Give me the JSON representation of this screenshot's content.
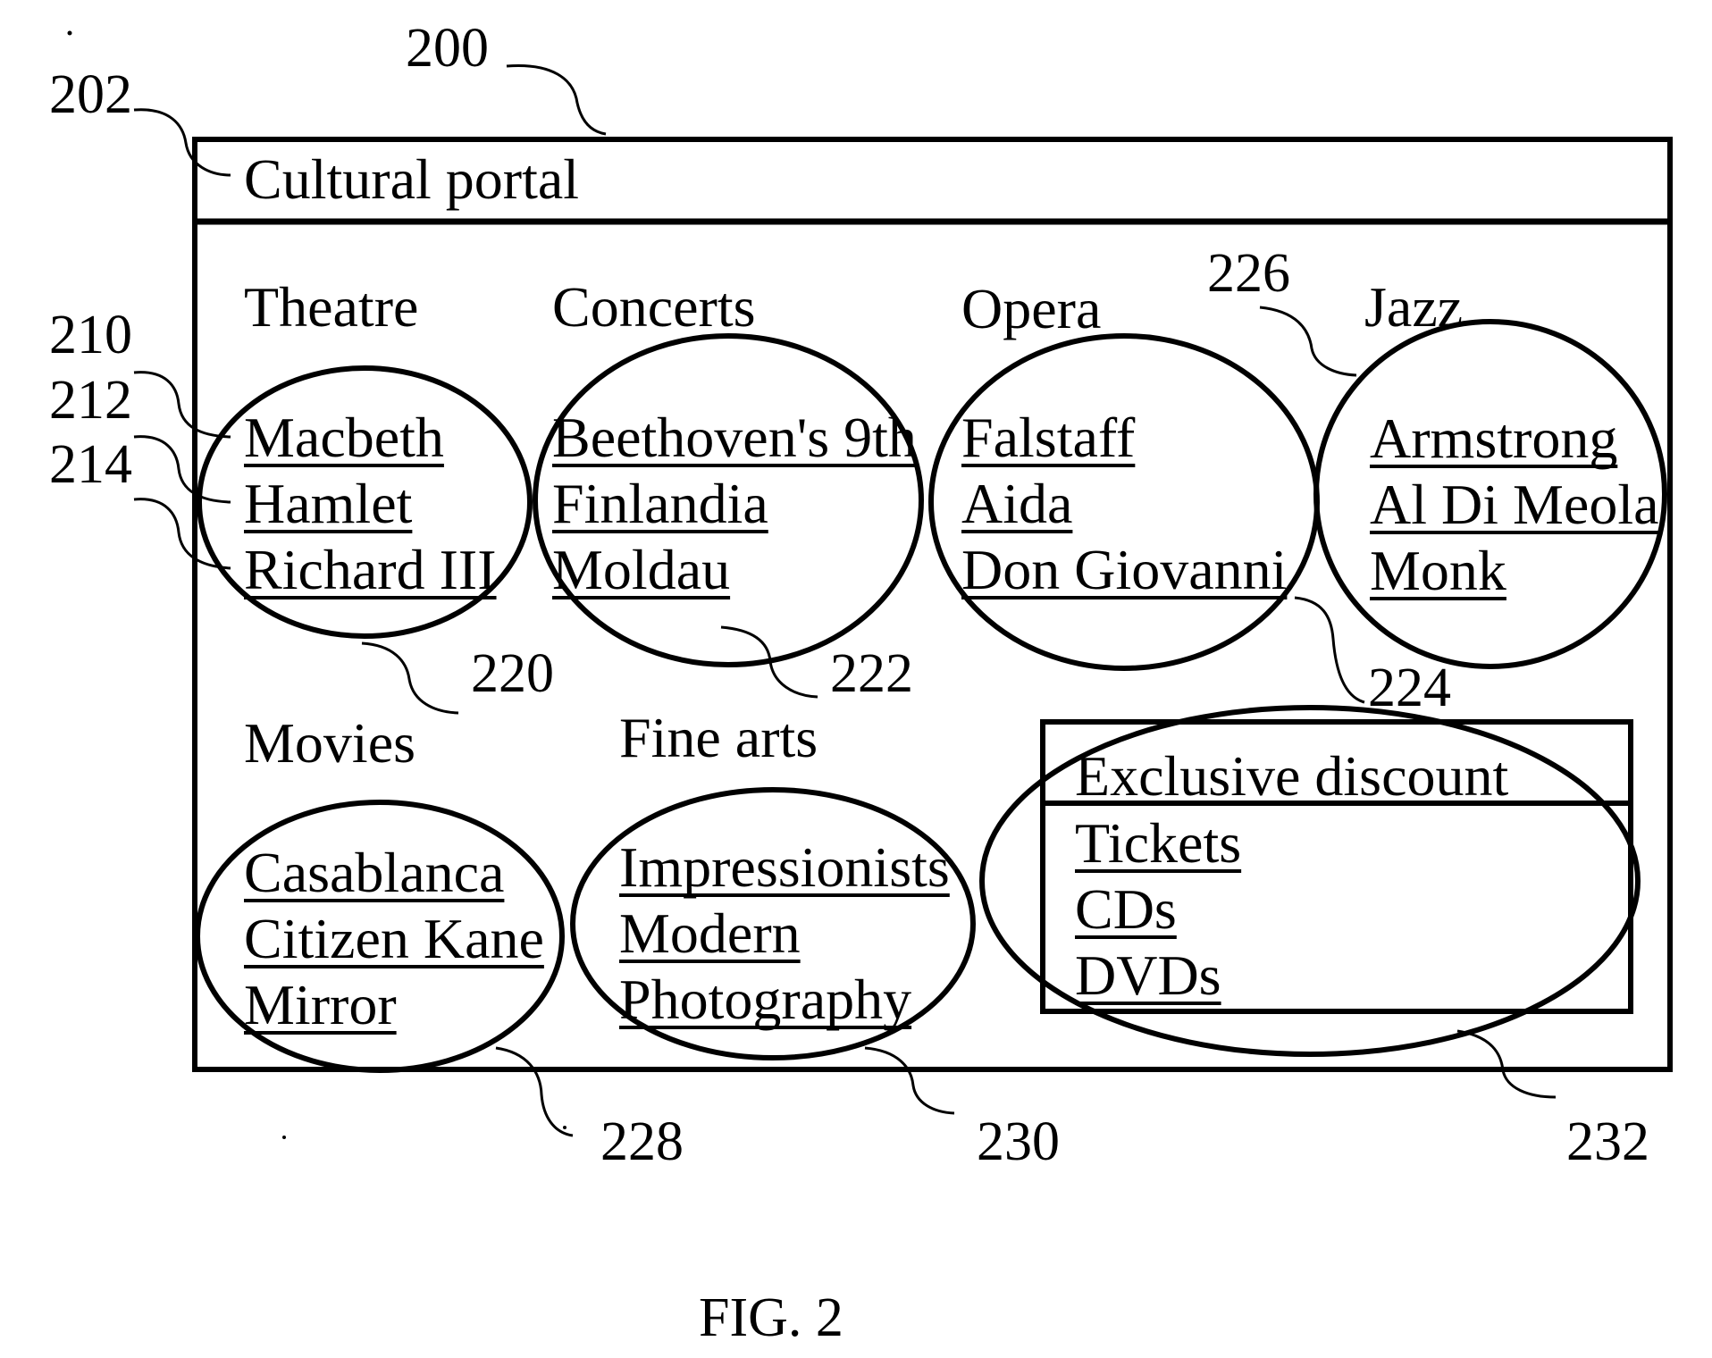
{
  "figure": {
    "caption": "FIG. 2",
    "stroke_color": "#000000",
    "background_color": "#ffffff"
  },
  "portal": {
    "ref": "200",
    "title": "Cultural portal",
    "title_ref": "202"
  },
  "categories": [
    {
      "heading": "Theatre",
      "group_ref": "220",
      "items": [
        {
          "label": "Macbeth",
          "ref": "210"
        },
        {
          "label": "Hamlet",
          "ref": "212"
        },
        {
          "label": "Richard III",
          "ref": "214"
        }
      ]
    },
    {
      "heading": "Concerts",
      "group_ref": "222",
      "items": [
        {
          "label": "Beethoven's 9th"
        },
        {
          "label": "Finlandia"
        },
        {
          "label": "Moldau"
        }
      ]
    },
    {
      "heading": "Opera",
      "group_ref": "224",
      "items": [
        {
          "label": "Falstaff"
        },
        {
          "label": "Aida"
        },
        {
          "label": "Don Giovanni"
        }
      ]
    },
    {
      "heading": "Jazz",
      "group_ref": "226",
      "items": [
        {
          "label": "Armstrong"
        },
        {
          "label": "Al Di Meola"
        },
        {
          "label": "Monk"
        }
      ]
    },
    {
      "heading": "Movies",
      "group_ref": "228",
      "items": [
        {
          "label": "Casablanca"
        },
        {
          "label": "Citizen Kane"
        },
        {
          "label": "Mirror"
        }
      ]
    },
    {
      "heading": "Fine arts",
      "group_ref": "230",
      "items": [
        {
          "label": "Impressionists"
        },
        {
          "label": "Modern"
        },
        {
          "label": "Photography"
        }
      ]
    }
  ],
  "discount_box": {
    "heading": "Exclusive discount",
    "group_ref": "232",
    "items": [
      {
        "label": "Tickets"
      },
      {
        "label": "CDs"
      },
      {
        "label": "DVDs"
      }
    ]
  }
}
